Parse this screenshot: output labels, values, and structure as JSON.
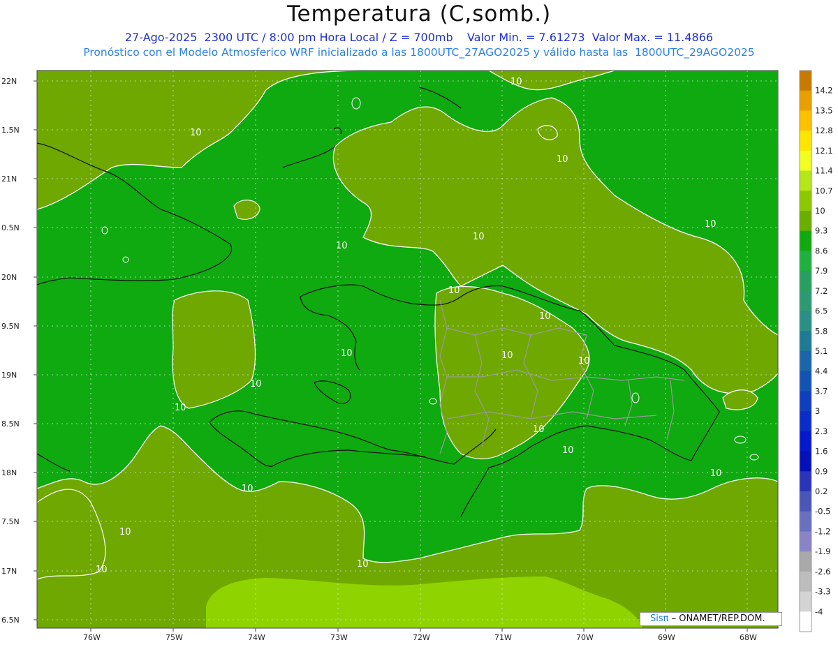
{
  "header": {
    "title": "Temperatura (C,somb.)",
    "line1": "27-Ago-2025  2300 UTC / 8:00 pm Hora Local / Z = 700mb    Valor Min. = 7.61273  Valor Max. = 11.4866",
    "line2": "Pronóstico con el Modelo Atmosferico WRF inicializado a las 1800UTC_27AGO2025 y válido hasta las  1800UTC_29AGO2025"
  },
  "axes": {
    "lat_labels": [
      "22N",
      "1.5N",
      "21N",
      "0.5N",
      "20N",
      "9.5N",
      "19N",
      "8.5N",
      "18N",
      "7.5N",
      "17N",
      "6.5N"
    ],
    "lon_labels": [
      "76W",
      "75W",
      "74W",
      "73W",
      "72W",
      "71W",
      "70W",
      "69W",
      "68W"
    ]
  },
  "contour_labels": [
    "10",
    "10",
    "10",
    "10",
    "10",
    "10",
    "10",
    "10",
    "10",
    "10",
    "10",
    "10",
    "10",
    "10",
    "10",
    "10",
    "10",
    "10",
    "10",
    "10"
  ],
  "colorbar": {
    "labels": [
      "14.2",
      "13.5",
      "12.8",
      "12.1",
      "11.4",
      "10.7",
      "10",
      "9.3",
      "8.6",
      "7.9",
      "7.2",
      "6.5",
      "5.8",
      "5.1",
      "4.4",
      "3.7",
      "3",
      "2.3",
      "1.6",
      "0.9",
      "0.2",
      "-0.5",
      "-1.2",
      "-1.9",
      "-2.6",
      "-3.3",
      "-4"
    ],
    "colors": [
      "#c87a00",
      "#e8a000",
      "#ffc000",
      "#ffe600",
      "#f0ff20",
      "#b5e619",
      "#8cc800",
      "#6aae00",
      "#10aa10",
      "#20b040",
      "#28a060",
      "#2d9a74",
      "#2a8f84",
      "#1f7a96",
      "#1a66a8",
      "#1452b4",
      "#0f3fbe",
      "#0a2cc8",
      "#0618cc",
      "#0610b8",
      "#2a34b8",
      "#4a56b8",
      "#6a70c0",
      "#8a84c6",
      "#a9a9a9",
      "#bdbdbd",
      "#d4d4d4",
      "#ffffff"
    ]
  },
  "credit": {
    "logo": "Sisπ",
    "text": "– ONAMET/REP.DOM."
  },
  "colors": {
    "warm_field": "#6fa800",
    "cool_field": "#0fa910",
    "warmest_band": "#8fd400",
    "contour": "#ffffff",
    "coast": "#111111",
    "provinces": "#9a9a9a"
  }
}
